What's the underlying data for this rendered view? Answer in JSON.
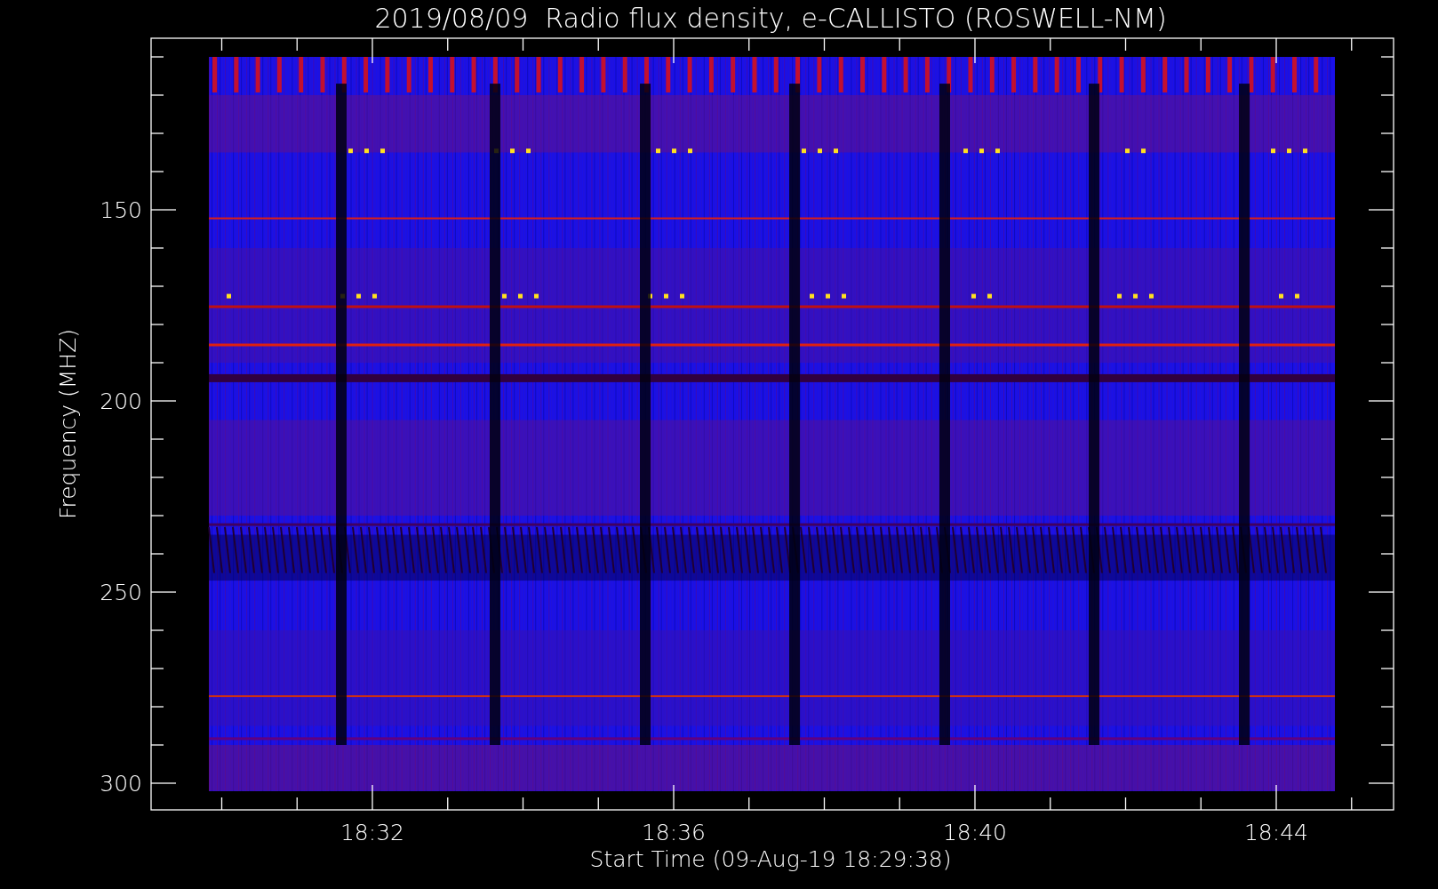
{
  "title": "2019/08/09  Radio flux density, e-CALLISTO (ROSWELL-NM)",
  "plot": {
    "ylabel": "Frequency (MHZ)",
    "xlabel": "Start Time (09-Aug-19 18:29:38)",
    "y_tick_labels": [
      "150",
      "200",
      "250",
      "300"
    ],
    "x_tick_labels": [
      "18:32",
      "18:36",
      "18:40",
      "18:44"
    ]
  }
}
